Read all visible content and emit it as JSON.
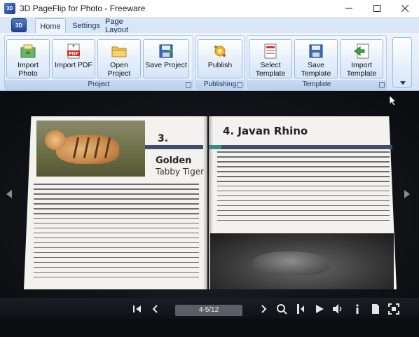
{
  "window": {
    "title": "3D PageFlip for Photo - Freeware",
    "app_icon": "3D"
  },
  "ribbon": {
    "app_button": "3D",
    "tabs": [
      {
        "label": "Home",
        "active": true
      },
      {
        "label": "Settings",
        "active": false
      },
      {
        "label": "Page Layout",
        "active": false
      }
    ],
    "groups": {
      "project": {
        "label": "Project",
        "buttons": [
          {
            "label": "Import Photo",
            "icon": "import-photo-icon"
          },
          {
            "label": "Import PDF",
            "icon": "pdf-icon"
          },
          {
            "label": "Open Project",
            "icon": "folder-icon"
          },
          {
            "label": "Save Project",
            "icon": "save-icon"
          }
        ]
      },
      "publishing": {
        "label": "Publishing",
        "buttons": [
          {
            "label": "Publish",
            "icon": "publish-icon"
          }
        ]
      },
      "template": {
        "label": "Template",
        "buttons": [
          {
            "label": "Select Template",
            "icon": "select-template-icon"
          },
          {
            "label": "Save Template",
            "icon": "save-template-icon"
          },
          {
            "label": "Import Template",
            "icon": "import-template-icon"
          }
        ]
      }
    }
  },
  "book": {
    "left_page": {
      "number": "3.",
      "title": "Golden",
      "subtitle": "Tabby Tiger"
    },
    "right_page": {
      "title": "4. Javan Rhino"
    }
  },
  "toolbar": {
    "page_indicator": "4-5/12",
    "icons": [
      "first-page-icon",
      "previous-page-icon",
      "next-page-icon",
      "zoom-icon",
      "fit-icon",
      "play-icon",
      "volume-icon",
      "info-icon",
      "file-icon",
      "fullscreen-icon"
    ]
  },
  "colors": {
    "ribbon_bg": "#dfeaf8",
    "stage_bg": "#121419",
    "title_bar_accent": "#3d4f6a",
    "page_paper": "#f4f2ee"
  }
}
